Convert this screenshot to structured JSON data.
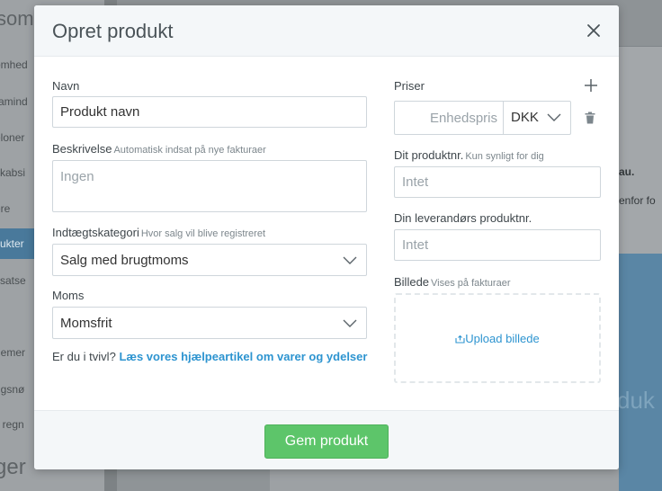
{
  "background": {
    "brand": "som",
    "sidebar_items": [
      "omhed",
      "ramind",
      "eloner",
      "skabsi",
      "ere",
      "ukter",
      "ssatse",
      "nemer",
      "ngsnø",
      "il regn"
    ],
    "sidebar_footer": "ger",
    "main_text_1": "au.",
    "main_text_2": "enfor fo",
    "main_big": "duk"
  },
  "modal": {
    "title": "Opret produkt",
    "close_icon": "close-icon",
    "name": {
      "label": "Navn",
      "value": "Produkt navn"
    },
    "description": {
      "label": "Beskrivelse",
      "hint": "Automatisk indsat på nye fakturaer",
      "placeholder": "Ingen"
    },
    "income_category": {
      "label": "Indtægtskategori",
      "hint": "Hvor salg vil blive registreret",
      "value": "Salg med brugtmoms"
    },
    "vat": {
      "label": "Moms",
      "value": "Momsfrit"
    },
    "help": {
      "prefix": "Er du i tvivl?",
      "link": "Læs vores hjælpeartikel om varer og ydelser"
    },
    "prices": {
      "label": "Priser",
      "placeholder": "Enhedspris",
      "currency": "DKK"
    },
    "product_no": {
      "label": "Dit produktnr.",
      "hint": "Kun synligt for dig",
      "placeholder": "Intet"
    },
    "supplier_no": {
      "label": "Din leverandørs produktnr.",
      "placeholder": "Intet"
    },
    "image": {
      "label": "Billede",
      "hint": "Vises på fakturaer",
      "upload_label": "Upload billede"
    },
    "save_label": "Gem produkt"
  }
}
